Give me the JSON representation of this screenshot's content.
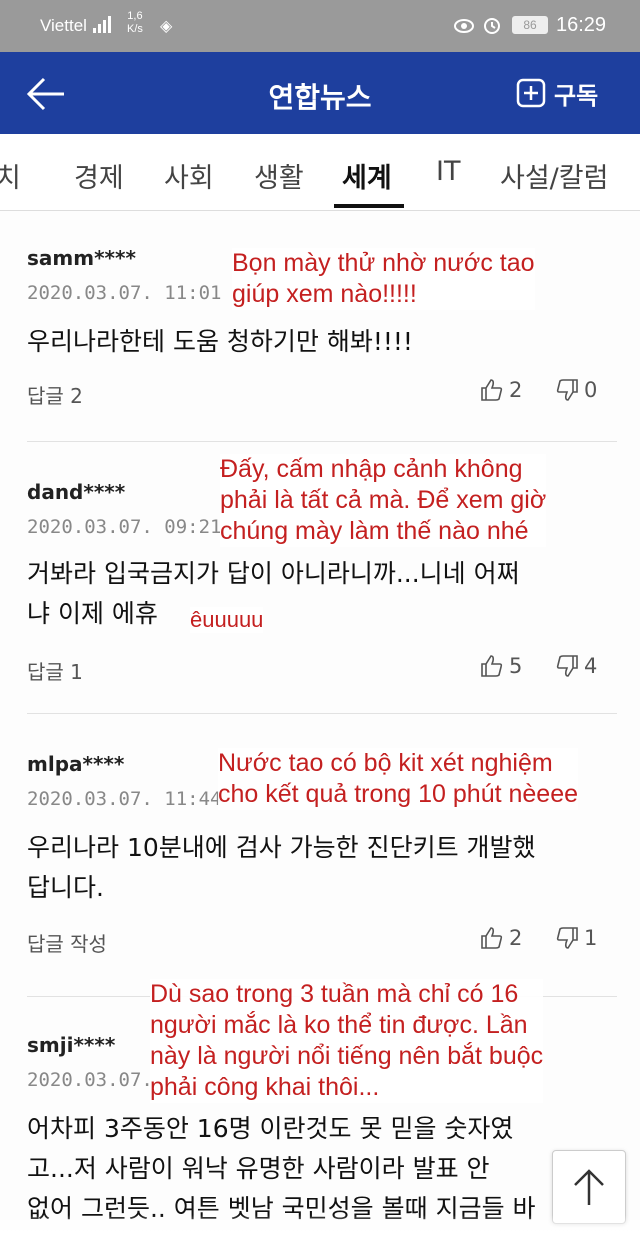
{
  "status_bar": {
    "carrier": "Viettel",
    "net_speed_value": "1,6",
    "net_speed_unit": "K/s",
    "battery": "86",
    "time": "16:29"
  },
  "app_bar": {
    "title": "연합뉴스",
    "subscribe_label": "구독"
  },
  "tabs": [
    {
      "label": "치",
      "active": false
    },
    {
      "label": "경제",
      "active": false
    },
    {
      "label": "사회",
      "active": false
    },
    {
      "label": "생활",
      "active": false
    },
    {
      "label": "세계",
      "active": true
    },
    {
      "label": "IT",
      "active": false
    },
    {
      "label": "사설/칼럼",
      "active": false
    }
  ],
  "comments": [
    {
      "user": "samm****",
      "date": "2020.03.07. 11:01",
      "text": "우리나라한테 도움 청하기만 해봐!!!!",
      "reply_label": "답글 2",
      "likes": "2",
      "dislikes": "0",
      "annotation": "Bọn mày thử nhờ nước tao\ngiúp xem nào!!!!!"
    },
    {
      "user": "dand****",
      "date": "2020.03.07. 09:21",
      "text": "거봐라 입국금지가 답이 아니라니까...니네 어쩌\n냐 이제 에휴",
      "reply_label": "답글 1",
      "likes": "5",
      "dislikes": "4",
      "annotation": "Đấy, cấm nhập cảnh không\nphải là tất cả mà. Để xem giờ\nchúng mày làm thế nào nhé",
      "annotation_extra": "êuuuuu"
    },
    {
      "user": "mlpa****",
      "date": "2020.03.07. 11:44",
      "text": "우리나라 10분내에 검사 가능한 진단키트 개발했\n답니다.",
      "reply_label": "답글 작성",
      "likes": "2",
      "dislikes": "1",
      "annotation": "Nước tao có bộ kit xét nghiệm\ncho kết quả trong 10 phút nèeee"
    },
    {
      "user": "smji****",
      "date": "2020.03.07.",
      "text": "어차피 3주동안 16명 이란것도 못 믿을 숫자였\n고...저 사람이 워낙 유명한 사람이라 발표 안\n없어 그런듯.. 여튼 벳남 국민성을 볼때 지금들 바",
      "annotation": "Dù sao trong 3 tuần mà chỉ có 16\nngười mắc là ko thể tin được. Lần\nnày là người nổi tiếng nên bắt buộc\nphải công khai thôi..."
    }
  ],
  "icons": {
    "back": "back-arrow-icon",
    "subscribe": "plus-square-icon",
    "like": "thumbs-up-icon",
    "dislike": "thumbs-down-icon",
    "scroll_top": "arrow-up-icon"
  },
  "colors": {
    "app_bar": "#1e3f9e",
    "annotation": "#c42020",
    "status_bar": "#9a9a9a"
  }
}
